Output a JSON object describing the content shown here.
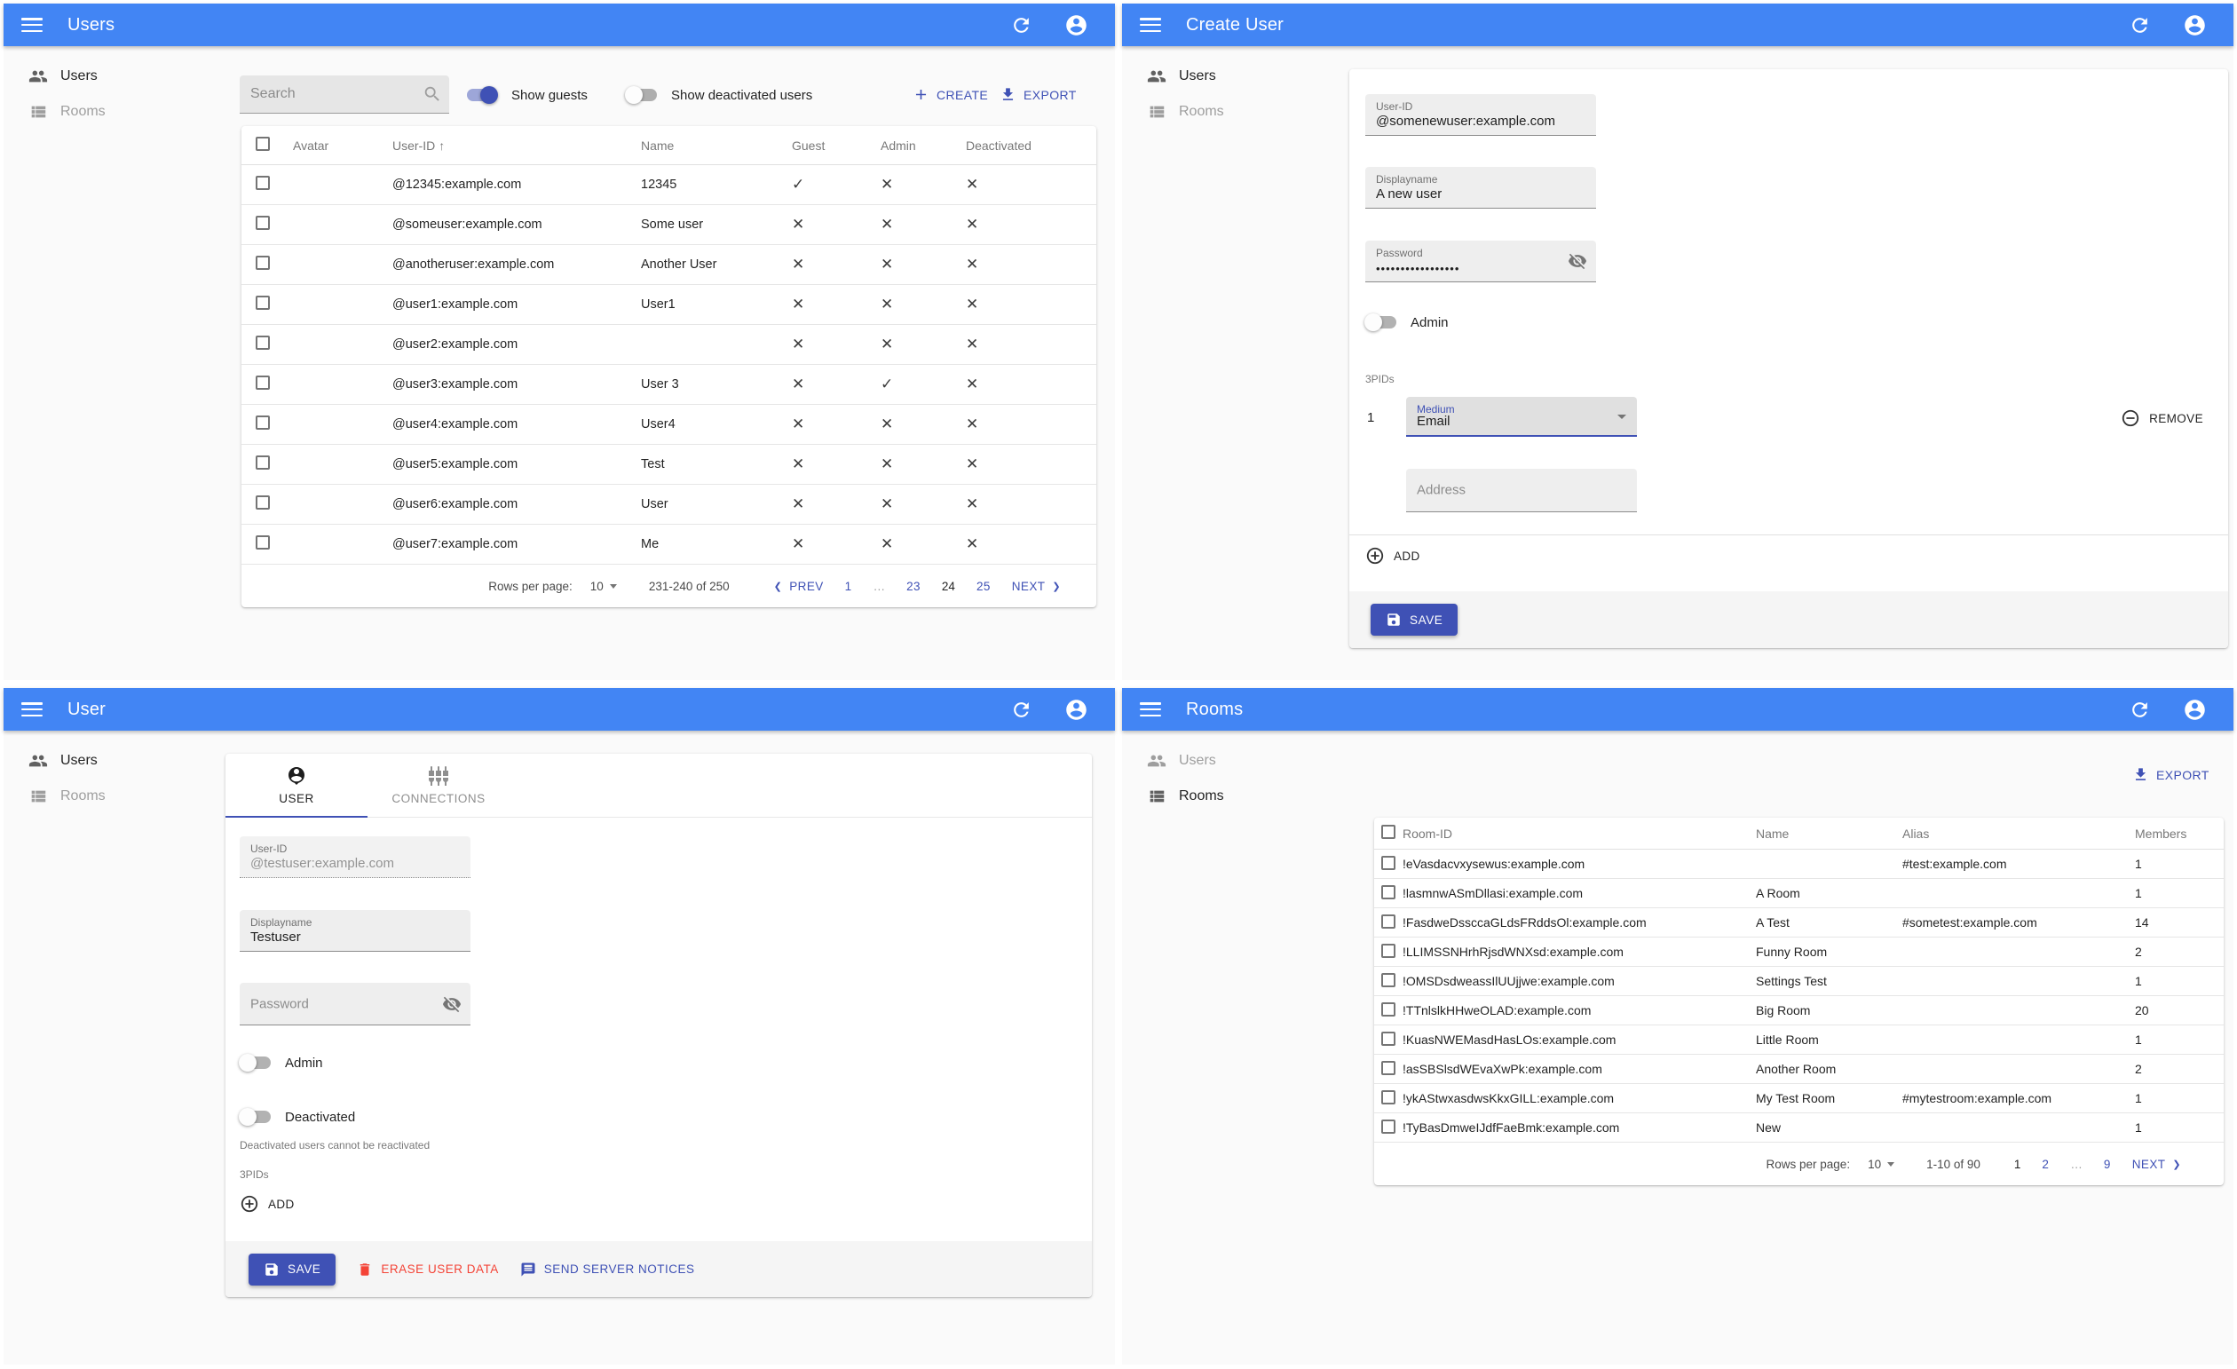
{
  "theme": {
    "appbar": "#4285f4",
    "primary": "#3f51b5",
    "danger": "#f44336"
  },
  "glyphs": {
    "check": "✓",
    "clear": "✕",
    "sort_asc": "↑",
    "chevron_left": "❮",
    "chevron_right": "❯"
  },
  "sidebar": {
    "users_label": "Users",
    "rooms_label": "Rooms"
  },
  "panels": {
    "users_list": {
      "appbar_title": "Users",
      "search_placeholder": "Search",
      "toggles": [
        {
          "label": "Show guests",
          "on": true
        },
        {
          "label": "Show deactivated users",
          "on": false
        }
      ],
      "create_label": "CREATE",
      "export_label": "EXPORT",
      "table": {
        "headers": {
          "avatar": "Avatar",
          "user_id": "User-ID",
          "name": "Name",
          "guest": "Guest",
          "admin": "Admin",
          "deactivated": "Deactivated"
        },
        "rows": [
          {
            "user_id": "@12345:example.com",
            "name": "12345",
            "guest": true,
            "admin": false,
            "deactivated": false
          },
          {
            "user_id": "@someuser:example.com",
            "name": "Some user",
            "guest": false,
            "admin": false,
            "deactivated": false
          },
          {
            "user_id": "@anotheruser:example.com",
            "name": "Another User",
            "guest": false,
            "admin": false,
            "deactivated": false
          },
          {
            "user_id": "@user1:example.com",
            "name": "User1",
            "guest": false,
            "admin": false,
            "deactivated": false
          },
          {
            "user_id": "@user2:example.com",
            "name": "",
            "guest": false,
            "admin": false,
            "deactivated": false
          },
          {
            "user_id": "@user3:example.com",
            "name": "User 3",
            "guest": false,
            "admin": true,
            "deactivated": false
          },
          {
            "user_id": "@user4:example.com",
            "name": "User4",
            "guest": false,
            "admin": false,
            "deactivated": false
          },
          {
            "user_id": "@user5:example.com",
            "name": "Test",
            "guest": false,
            "admin": false,
            "deactivated": false
          },
          {
            "user_id": "@user6:example.com",
            "name": "User",
            "guest": false,
            "admin": false,
            "deactivated": false
          },
          {
            "user_id": "@user7:example.com",
            "name": "Me",
            "guest": false,
            "admin": false,
            "deactivated": false
          }
        ]
      },
      "pagination": {
        "rows_per_page_label": "Rows per page:",
        "rows_per_page_value": "10",
        "range": "231-240 of 250",
        "items": [
          {
            "type": "prev",
            "label": "PREV"
          },
          {
            "type": "link",
            "label": "1"
          },
          {
            "type": "ellipsis",
            "label": "…"
          },
          {
            "type": "link",
            "label": "23"
          },
          {
            "type": "current",
            "label": "24"
          },
          {
            "type": "link",
            "label": "25"
          },
          {
            "type": "next",
            "label": "NEXT"
          }
        ]
      }
    },
    "create_user": {
      "appbar_title": "Create User",
      "user_id": {
        "label": "User-ID",
        "value": "@somenewuser:example.com"
      },
      "displayname": {
        "label": "Displayname",
        "value": "A new user"
      },
      "password": {
        "label": "Password",
        "masked_value": "•••••••••••••••••"
      },
      "admin_label": "Admin",
      "threepids_label": "3PIDs",
      "threepid_index": "1",
      "medium": {
        "label": "Medium",
        "value": "Email"
      },
      "remove_label": "REMOVE",
      "address_placeholder": "Address",
      "add_label": "ADD",
      "save_label": "SAVE"
    },
    "user_edit": {
      "appbar_title": "User",
      "tabs": {
        "user": "USER",
        "connections": "CONNECTIONS"
      },
      "user_id": {
        "label": "User-ID",
        "value": "@testuser:example.com"
      },
      "displayname": {
        "label": "Displayname",
        "value": "Testuser"
      },
      "password_placeholder": "Password",
      "admin_label": "Admin",
      "deactivated_label": "Deactivated",
      "deactivated_helper": "Deactivated users cannot be reactivated",
      "threepids_label": "3PIDs",
      "add_label": "ADD",
      "save_label": "SAVE",
      "erase_label": "ERASE USER DATA",
      "notices_label": "SEND SERVER NOTICES"
    },
    "rooms_list": {
      "appbar_title": "Rooms",
      "export_label": "EXPORT",
      "table": {
        "headers": {
          "room_id": "Room-ID",
          "name": "Name",
          "alias": "Alias",
          "members": "Members"
        },
        "rows": [
          {
            "room_id": "!eVasdacvxysewus:example.com",
            "name": "",
            "alias": "#test:example.com",
            "members": "1"
          },
          {
            "room_id": "!lasmnwASmDllasi:example.com",
            "name": "A Room",
            "alias": "",
            "members": "1"
          },
          {
            "room_id": "!FasdweDssccaGLdsFRddsOl:example.com",
            "name": "A Test",
            "alias": "#sometest:example.com",
            "members": "14"
          },
          {
            "room_id": "!LLIMSSNHrhRjsdWNXsd:example.com",
            "name": "Funny Room",
            "alias": "",
            "members": "2"
          },
          {
            "room_id": "!OMSDsdweassIlUUjjwe:example.com",
            "name": "Settings Test",
            "alias": "",
            "members": "1"
          },
          {
            "room_id": "!TTnlslkHHweOLAD:example.com",
            "name": "Big Room",
            "alias": "",
            "members": "20"
          },
          {
            "room_id": "!KuasNWEMasdHasLOs:example.com",
            "name": "Little Room",
            "alias": "",
            "members": "1"
          },
          {
            "room_id": "!asSBSlsdWEvaXwPk:example.com",
            "name": "Another Room",
            "alias": "",
            "members": "2"
          },
          {
            "room_id": "!ykAStwxasdwsKkxGILL:example.com",
            "name": "My Test Room",
            "alias": "#mytestroom:example.com",
            "members": "1"
          },
          {
            "room_id": "!TyBasDmweIJdfFaeBmk:example.com",
            "name": "New",
            "alias": "",
            "members": "1"
          }
        ]
      },
      "pagination": {
        "rows_per_page_label": "Rows per page:",
        "rows_per_page_value": "10",
        "range": "1-10 of 90",
        "items": [
          {
            "type": "current",
            "label": "1"
          },
          {
            "type": "link",
            "label": "2"
          },
          {
            "type": "ellipsis",
            "label": "…"
          },
          {
            "type": "link",
            "label": "9"
          },
          {
            "type": "next",
            "label": "NEXT"
          }
        ]
      }
    }
  }
}
